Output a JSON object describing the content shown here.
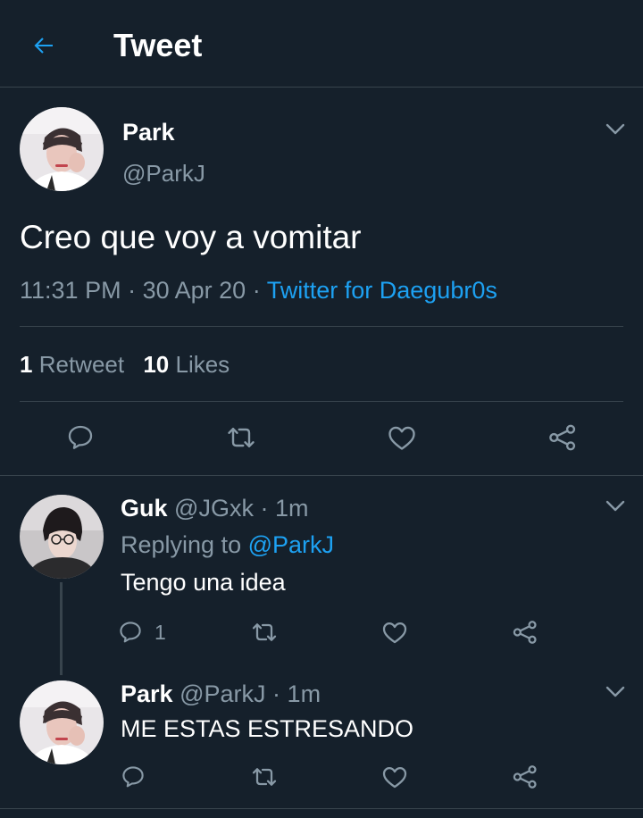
{
  "header": {
    "title": "Tweet",
    "back_icon": "arrow-left-icon"
  },
  "tweet": {
    "author_name": "Park",
    "author_handle": "@ParkJ",
    "text": "Creo que voy a vomitar",
    "time": "11:31 PM",
    "date": "30 Apr 20",
    "sep1": "·",
    "sep2": "·",
    "source": "Twitter for Daegubr0s",
    "retweets_count": "1",
    "retweets_label": "Retweet",
    "likes_count": "10",
    "likes_label": "Likes"
  },
  "replies": [
    {
      "author_name": "Guk",
      "author_handle": "@JGxk",
      "sep": "·",
      "time_ago": "1m",
      "replying_label": "Replying to",
      "replying_to": "@ParkJ",
      "text": "Tengo una idea",
      "reply_count": "1"
    },
    {
      "author_name": "Park",
      "author_handle": "@ParkJ",
      "sep": "·",
      "time_ago": "1m",
      "text": "ME ESTAS ESTRESANDO"
    }
  ],
  "colors": {
    "background": "#15202b",
    "accent": "#1da1f2",
    "muted": "#8899a6",
    "divider": "#38444d"
  }
}
